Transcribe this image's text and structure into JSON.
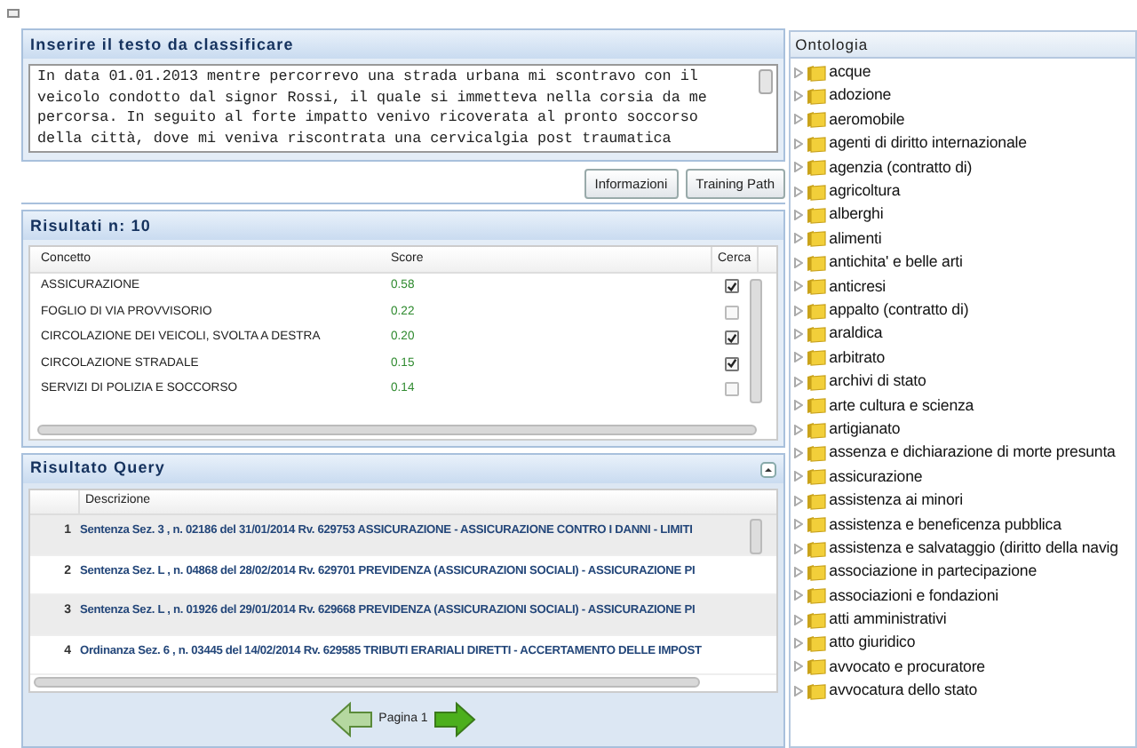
{
  "input_panel": {
    "title": "Inserire il testo da classificare",
    "text": "In data 01.01.2013 mentre percorrevo una strada urbana mi scontravo con il veicolo condotto dal signor Rossi, il quale si immetteva nella corsia da me percorsa. In seguito al forte impatto venivo ricoverata al pronto soccorso della città, dove mi veniva riscontrata una cervicalgia post traumatica"
  },
  "buttons": [
    "Informazioni",
    "Training Path"
  ],
  "results": {
    "title": "Risultati n: 10",
    "columns": [
      "Concetto",
      "Score",
      "Cerca"
    ],
    "rows": [
      {
        "concept": "ASSICURAZIONE",
        "score": "0.58",
        "checked": true
      },
      {
        "concept": "FOGLIO DI VIA PROVVISORIO",
        "score": "0.22",
        "checked": false
      },
      {
        "concept": "CIRCOLAZIONE DEI VEICOLI, SVOLTA A DESTRA",
        "score": "0.20",
        "checked": true
      },
      {
        "concept": "CIRCOLAZIONE STRADALE",
        "score": "0.15",
        "checked": true
      },
      {
        "concept": "SERVIZI DI POLIZIA E SOCCORSO",
        "score": "0.14",
        "checked": false
      }
    ]
  },
  "query": {
    "title": "Risultato Query",
    "column": "Descrizione",
    "rows": [
      {
        "number": "1",
        "text": "Sentenza Sez. 3 , n. 02186 del 31/01/2014 Rv. 629753 ASSICURAZIONE - ASSICURAZIONE CONTRO I DANNI - LIMITI",
        "selected": true
      },
      {
        "number": "2",
        "text": "Sentenza Sez. L , n. 04868 del 28/02/2014 Rv. 629701 PREVIDENZA (ASSICURAZIONI SOCIALI) - ASSICURAZIONE PI",
        "selected": false
      },
      {
        "number": "3",
        "text": "Sentenza Sez. L , n. 01926 del 29/01/2014 Rv. 629668 PREVIDENZA (ASSICURAZIONI SOCIALI) - ASSICURAZIONE PI",
        "selected": true
      },
      {
        "number": "4",
        "text": "Ordinanza Sez. 6 , n. 03445 del 14/02/2014 Rv. 629585 TRIBUTI ERARIALI DIRETTI - ACCERTAMENTO DELLE IMPOST",
        "selected": false
      }
    ],
    "pager": {
      "label": "Pagina 1",
      "prev_disabled": true,
      "next_disabled": false
    }
  },
  "ontology": {
    "title": "Ontologia",
    "items": [
      "acque",
      "adozione",
      "aeromobile",
      "agenti di diritto internazionale",
      "agenzia (contratto di)",
      "agricoltura",
      "alberghi",
      "alimenti",
      "antichita' e belle arti",
      "anticresi",
      "appalto (contratto di)",
      "araldica",
      "arbitrato",
      "archivi di stato",
      "arte cultura e scienza",
      "artigianato",
      "assenza e dichiarazione di morte presunta",
      "assicurazione",
      "assistenza ai minori",
      "assistenza e beneficenza pubblica",
      "assistenza e salvataggio (diritto della navig",
      "associazione in partecipazione",
      "associazioni e fondazioni",
      "atti amministrativi",
      "atto giuridico",
      "avvocato e procuratore",
      "avvocatura dello stato"
    ]
  }
}
